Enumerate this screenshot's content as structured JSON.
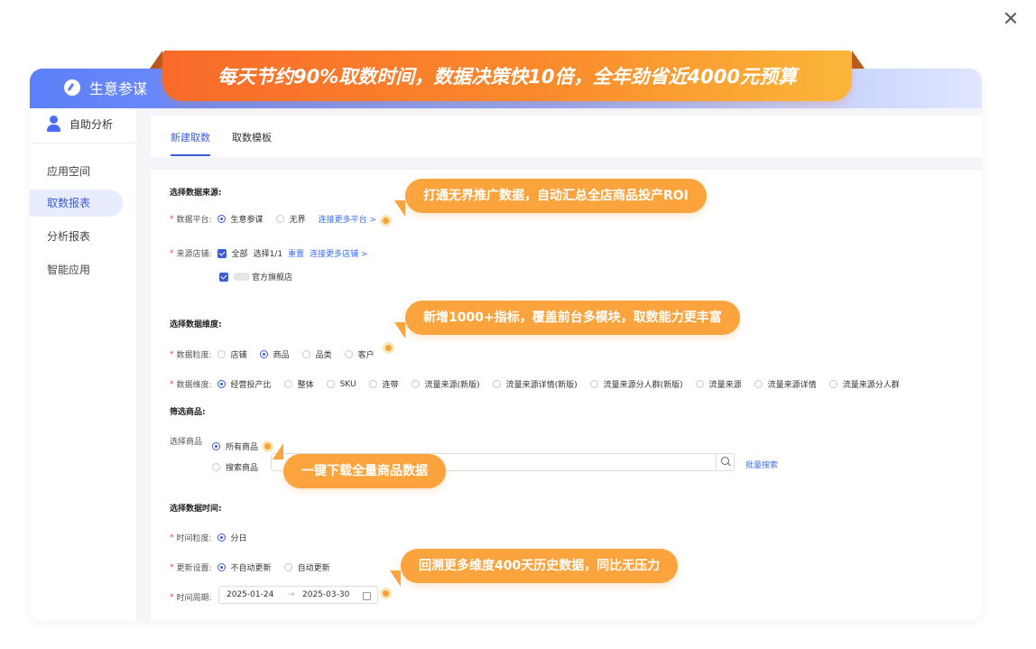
{
  "close_label": "×",
  "brand": {
    "title": "生意参谋"
  },
  "banner": {
    "text": "每天节约90%取数时间，数据决策快10倍，全年劲省近4000元预算"
  },
  "sidebar": {
    "header": "自助分析",
    "items": [
      {
        "label": "应用空间",
        "active": false
      },
      {
        "label": "取数报表",
        "active": true
      },
      {
        "label": "分析报表",
        "active": false
      },
      {
        "label": "智能应用",
        "active": false
      }
    ]
  },
  "tabs": [
    {
      "label": "新建取数",
      "active": true
    },
    {
      "label": "取数模板",
      "active": false
    }
  ],
  "source": {
    "section_title": "选择数据来源:",
    "platform": {
      "label": "数据平台:",
      "options": [
        "生意参谋",
        "无界"
      ],
      "selected": "生意参谋",
      "link": "连接更多平台 >"
    },
    "store": {
      "label": "来源店铺:",
      "all": "全部",
      "count": "选择1/1",
      "reset": "重置",
      "link": "连接更多店铺 >",
      "store_name": "官方旗舰店"
    }
  },
  "dimension": {
    "section_title": "选择数据维度:",
    "granularity": {
      "label": "数据粒度:",
      "options": [
        "店铺",
        "商品",
        "品类",
        "客户"
      ],
      "selected": "商品"
    },
    "dims": {
      "label": "数据维度:",
      "options": [
        "经营投产比",
        "整体",
        "SKU",
        "连带",
        "流量来源(新版)",
        "流量来源详情(新版)",
        "流量来源分人群(新版)",
        "流量来源",
        "流量来源详情",
        "流量来源分人群"
      ],
      "selected": "经营投产比"
    }
  },
  "filter": {
    "section_title": "筛选商品:",
    "label": "选择商品",
    "options": [
      "所有商品",
      "搜索商品"
    ],
    "selected": "所有商品",
    "batch_search": "批量搜索"
  },
  "time": {
    "section_title": "选择数据时间:",
    "granularity": {
      "label": "时间粒度:",
      "value": "分日"
    },
    "update": {
      "label": "更新设置:",
      "options": [
        "不自动更新",
        "自动更新"
      ],
      "selected": "不自动更新"
    },
    "period": {
      "label": "时间周期:",
      "start": "2025-01-24",
      "sep": "→",
      "end": "2025-03-30"
    }
  },
  "callouts": [
    "打通无界推广数据，自动汇总全店商品投产ROI",
    "新增1000+指标，覆盖前台多模块，取数能力更丰富",
    "一键下载全量商品数据",
    "回溯更多维度400天历史数据，同比无压力"
  ],
  "colors": {
    "accent": "#3b5bdb",
    "banner_start": "#f96a2a",
    "banner_end": "#fbb63a",
    "callout": "#fba33c"
  }
}
